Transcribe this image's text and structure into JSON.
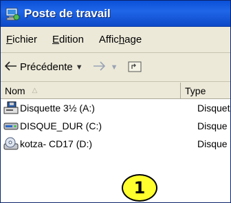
{
  "window": {
    "title": "Poste de travail",
    "title_icon": "my-computer-icon"
  },
  "menu": {
    "items": [
      {
        "label": "Fichier",
        "mnemonic": "F"
      },
      {
        "label": "Edition",
        "mnemonic": "E"
      },
      {
        "label": "Affichage",
        "mnemonic": "h"
      }
    ]
  },
  "toolbar": {
    "back_label": "Précédente",
    "back_icon": "back-arrow-icon",
    "forward_icon": "forward-arrow-icon",
    "up_icon": "folder-up-icon"
  },
  "list": {
    "headers": {
      "name": "Nom",
      "type": "Type"
    },
    "rows": [
      {
        "name": "Disquette 3½ (A:)",
        "type": "Disquet",
        "icon": "floppy-drive-icon"
      },
      {
        "name": "DISQUE_DUR (C:)",
        "type": "Disque",
        "icon": "hard-drive-icon"
      },
      {
        "name": "kotza- CD17 (D:)",
        "type": "Disque",
        "icon": "cd-drive-icon"
      }
    ]
  },
  "callout": {
    "label": "1",
    "color": "#ffff2e"
  },
  "colors": {
    "titlebar": "#1f66e8",
    "chrome": "#ece9d8"
  }
}
